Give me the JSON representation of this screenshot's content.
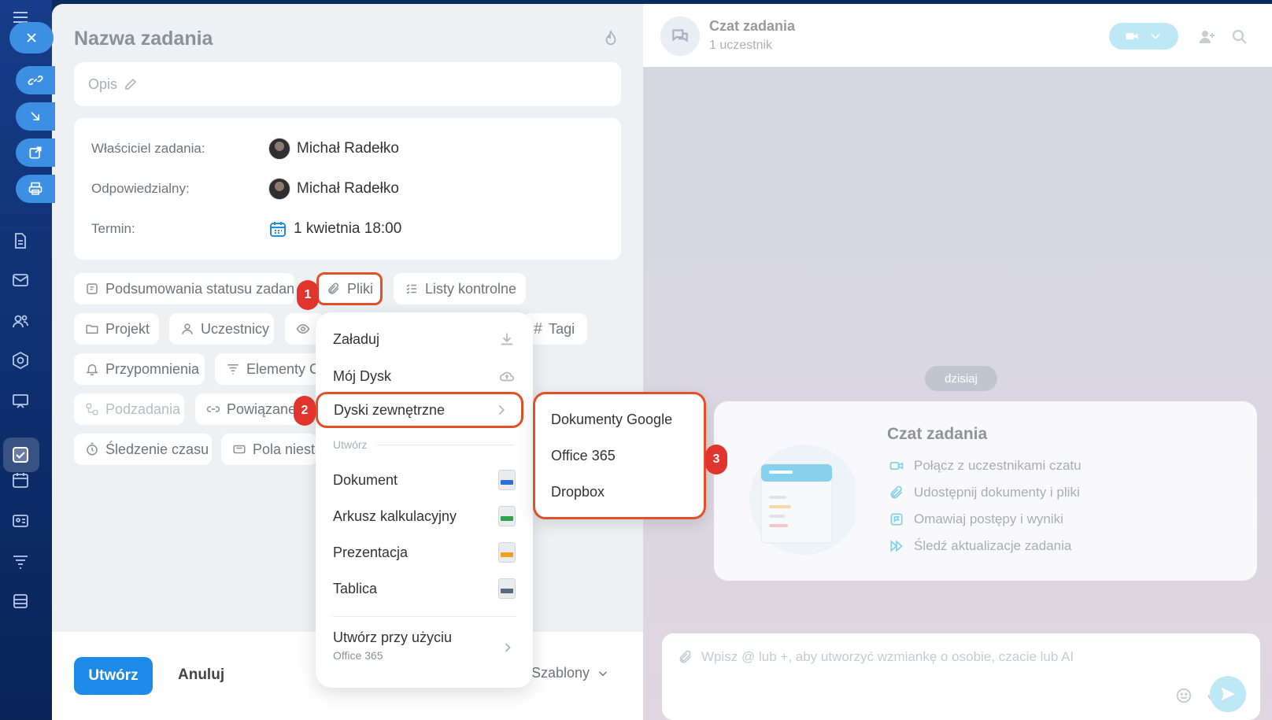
{
  "task": {
    "title": "Nazwa zadania",
    "description_placeholder": "Opis",
    "owner_label": "Właściciel zadania:",
    "owner_name": "Michał Radełko",
    "responsible_label": "Odpowiedzialny:",
    "responsible_name": "Michał Radełko",
    "deadline_label": "Termin:",
    "deadline_value": "1 kwietnia 18:00"
  },
  "chips": {
    "status_summary": "Podsumowania statusu zadania",
    "files": "Pliki",
    "checklists": "Listy kontrolne",
    "project": "Projekt",
    "participants": "Uczestnicy",
    "tags": "Tagi",
    "reminders": "Przypomnienia",
    "elements": "Elementy CRM",
    "subtasks": "Podzadania",
    "related": "Powiązane zadania",
    "time_tracking": "Śledzenie czasu",
    "custom_fields": "Pola niestandardowe"
  },
  "steps": {
    "one": "1",
    "two": "2",
    "three": "3"
  },
  "menu": {
    "upload": "Załaduj",
    "my_drive": "Mój Dysk",
    "external_drives": "Dyski zewnętrzne",
    "create_section": "Utwórz",
    "document": "Dokument",
    "spreadsheet": "Arkusz kalkulacyjny",
    "presentation": "Prezentacja",
    "board": "Tablica",
    "create_using": "Utwórz przy użyciu",
    "create_using_sub": "Office 365"
  },
  "submenu": {
    "google_docs": "Dokumenty Google",
    "office365": "Office 365",
    "dropbox": "Dropbox"
  },
  "footer": {
    "create": "Utwórz",
    "cancel": "Anuluj",
    "templates": "Szablony"
  },
  "chat": {
    "title": "Czat zadania",
    "subtitle": "1 uczestnik",
    "date_pill": "dzisiaj",
    "card_title": "Czat zadania",
    "card_items": [
      "Połącz z uczestnikami czatu",
      "Udostępnij dokumenty i pliki",
      "Omawiaj postępy i wyniki",
      "Śledź aktualizacje zadania"
    ],
    "input_placeholder": "Wpisz @ lub +, aby utworzyć wzmiankę o osobie, czacie lub AI"
  },
  "colors": {
    "accent": "#1e8ae8",
    "highlight": "#e0512a",
    "badge": "#e0342c",
    "sidebar": "#163d8a"
  }
}
